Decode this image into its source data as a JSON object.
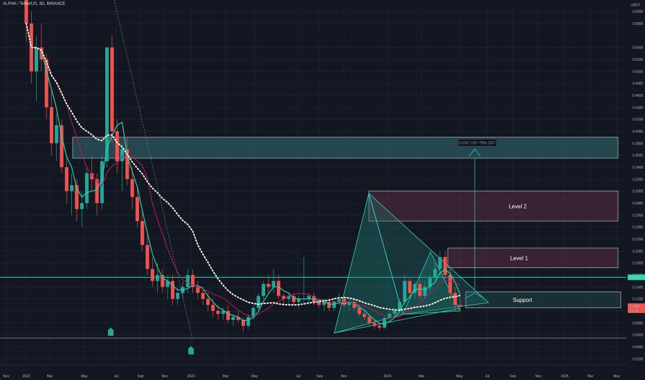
{
  "header": {
    "title": "ALPHA / TetherUS, 3D, BINANCE"
  },
  "colors": {
    "background": "#131722",
    "grid": "#1e222d",
    "up_candle": "#26a69a",
    "down_candle": "#ef5350",
    "ema_fast": "#26d4b0",
    "ema_slow": "#c2185b",
    "dotted_ma": "#f5f5dc",
    "support_line": "#2bd9b7",
    "target_zone": "#2e5a62",
    "resistance_zone": "#4a2a3a",
    "triangle_fill": "#1f8c7e",
    "arrow": "#26c6b0",
    "signal_marker": "#26a69a"
  },
  "chart_data": {
    "type": "candlestick",
    "title": "ALPHA / TetherUS, 3D, BINANCE",
    "y_axis": {
      "unit": "USDT",
      "ticks": [
        "0.6000",
        "0.5800",
        "0.5400",
        "0.5200",
        "0.5000",
        "0.4800",
        "0.4600",
        "0.4400",
        "0.4200",
        "0.4000",
        "0.3800",
        "0.3600",
        "0.3400",
        "0.3200",
        "0.3000",
        "0.2800",
        "0.2600",
        "0.2400",
        "0.2200",
        "0.2000",
        "0.1800",
        "0.1600",
        "0.1400",
        "0.1200",
        "0.1000",
        "0.0800",
        "0.0600",
        "0.0400",
        "0.0200"
      ],
      "ylim": [
        0.02,
        0.6
      ]
    },
    "x_axis": {
      "ticks": [
        "Nov",
        "2022",
        "Mar",
        "May",
        "Jul",
        "Sep",
        "Nov",
        "2023",
        "Mar",
        "May",
        "Jul",
        "Sep",
        "Nov",
        "2024",
        "Mar",
        "May",
        "Jul",
        "Sep",
        "Nov",
        "2025",
        "Mar",
        "May"
      ]
    },
    "price_labels": {
      "support_line": "0.1561",
      "current_price": "0.1080",
      "countdown": "1d 4h"
    },
    "measure_label": "0.2327 (167.75%) 2327",
    "zones": [
      {
        "name": "target",
        "label": "",
        "y_top": 0.39,
        "y_bottom": 0.355
      },
      {
        "name": "level2",
        "label": "Level 2",
        "y_top": 0.3,
        "y_bottom": 0.25
      },
      {
        "name": "level1",
        "label": "Level 1",
        "y_top": 0.205,
        "y_bottom": 0.172
      },
      {
        "name": "support",
        "label": "Support",
        "y_top": 0.132,
        "y_bottom": 0.105
      }
    ],
    "horizontal_lines": [
      {
        "name": "support-line",
        "value": 0.1561
      },
      {
        "name": "floor-line",
        "value": 0.0548
      }
    ],
    "candles": [
      [
        0.62,
        0.64,
        0.55,
        0.58
      ],
      [
        0.58,
        0.6,
        0.48,
        0.5
      ],
      [
        0.5,
        0.56,
        0.45,
        0.54
      ],
      [
        0.54,
        0.58,
        0.5,
        0.52
      ],
      [
        0.52,
        0.53,
        0.42,
        0.44
      ],
      [
        0.44,
        0.47,
        0.36,
        0.38
      ],
      [
        0.38,
        0.43,
        0.35,
        0.41
      ],
      [
        0.41,
        0.42,
        0.33,
        0.34
      ],
      [
        0.34,
        0.36,
        0.28,
        0.3
      ],
      [
        0.3,
        0.33,
        0.26,
        0.31
      ],
      [
        0.31,
        0.32,
        0.25,
        0.27
      ],
      [
        0.27,
        0.3,
        0.24,
        0.28
      ],
      [
        0.28,
        0.34,
        0.27,
        0.33
      ],
      [
        0.33,
        0.36,
        0.3,
        0.32
      ],
      [
        0.32,
        0.33,
        0.26,
        0.28
      ],
      [
        0.28,
        0.36,
        0.27,
        0.35
      ],
      [
        0.35,
        0.54,
        0.34,
        0.54
      ],
      [
        0.54,
        0.56,
        0.38,
        0.4
      ],
      [
        0.4,
        0.42,
        0.33,
        0.35
      ],
      [
        0.35,
        0.38,
        0.3,
        0.37
      ],
      [
        0.37,
        0.39,
        0.31,
        0.32
      ],
      [
        0.32,
        0.34,
        0.27,
        0.29
      ],
      [
        0.29,
        0.31,
        0.24,
        0.25
      ],
      [
        0.25,
        0.27,
        0.2,
        0.21
      ],
      [
        0.21,
        0.23,
        0.16,
        0.17
      ],
      [
        0.17,
        0.19,
        0.14,
        0.15
      ],
      [
        0.15,
        0.18,
        0.13,
        0.16
      ],
      [
        0.16,
        0.17,
        0.13,
        0.14
      ],
      [
        0.14,
        0.16,
        0.12,
        0.15
      ],
      [
        0.15,
        0.16,
        0.11,
        0.12
      ],
      [
        0.12,
        0.14,
        0.11,
        0.13
      ],
      [
        0.13,
        0.15,
        0.12,
        0.14
      ],
      [
        0.14,
        0.17,
        0.13,
        0.16
      ],
      [
        0.16,
        0.17,
        0.13,
        0.14
      ],
      [
        0.14,
        0.15,
        0.12,
        0.13
      ],
      [
        0.13,
        0.14,
        0.11,
        0.12
      ],
      [
        0.12,
        0.13,
        0.1,
        0.11
      ],
      [
        0.11,
        0.12,
        0.09,
        0.1
      ],
      [
        0.1,
        0.11,
        0.085,
        0.095
      ],
      [
        0.095,
        0.105,
        0.085,
        0.1
      ],
      [
        0.1,
        0.11,
        0.08,
        0.085
      ],
      [
        0.085,
        0.095,
        0.075,
        0.09
      ],
      [
        0.09,
        0.1,
        0.08,
        0.085
      ],
      [
        0.085,
        0.09,
        0.065,
        0.075
      ],
      [
        0.075,
        0.095,
        0.07,
        0.09
      ],
      [
        0.09,
        0.11,
        0.085,
        0.105
      ],
      [
        0.105,
        0.13,
        0.1,
        0.125
      ],
      [
        0.125,
        0.15,
        0.12,
        0.145
      ],
      [
        0.145,
        0.16,
        0.13,
        0.14
      ],
      [
        0.14,
        0.17,
        0.13,
        0.15
      ],
      [
        0.15,
        0.16,
        0.12,
        0.125
      ],
      [
        0.125,
        0.13,
        0.11,
        0.12
      ],
      [
        0.12,
        0.13,
        0.11,
        0.125
      ],
      [
        0.125,
        0.13,
        0.11,
        0.115
      ],
      [
        0.115,
        0.125,
        0.105,
        0.12
      ],
      [
        0.12,
        0.19,
        0.11,
        0.12
      ],
      [
        0.12,
        0.13,
        0.11,
        0.125
      ],
      [
        0.125,
        0.13,
        0.11,
        0.115
      ],
      [
        0.115,
        0.12,
        0.105,
        0.11
      ],
      [
        0.11,
        0.12,
        0.1,
        0.115
      ],
      [
        0.115,
        0.12,
        0.1,
        0.105
      ],
      [
        0.105,
        0.12,
        0.1,
        0.115
      ],
      [
        0.115,
        0.13,
        0.11,
        0.12
      ],
      [
        0.12,
        0.125,
        0.105,
        0.11
      ],
      [
        0.11,
        0.12,
        0.1,
        0.115
      ],
      [
        0.115,
        0.12,
        0.1,
        0.105
      ],
      [
        0.105,
        0.11,
        0.09,
        0.095
      ],
      [
        0.095,
        0.1,
        0.085,
        0.09
      ],
      [
        0.09,
        0.095,
        0.075,
        0.08
      ],
      [
        0.08,
        0.085,
        0.07,
        0.075
      ],
      [
        0.075,
        0.08,
        0.068,
        0.072
      ],
      [
        0.072,
        0.09,
        0.07,
        0.088
      ],
      [
        0.088,
        0.1,
        0.085,
        0.095
      ],
      [
        0.095,
        0.105,
        0.09,
        0.1
      ],
      [
        0.1,
        0.12,
        0.095,
        0.115
      ],
      [
        0.115,
        0.16,
        0.11,
        0.15
      ],
      [
        0.15,
        0.155,
        0.12,
        0.13
      ],
      [
        0.13,
        0.15,
        0.12,
        0.145
      ],
      [
        0.145,
        0.15,
        0.12,
        0.125
      ],
      [
        0.125,
        0.15,
        0.12,
        0.14
      ],
      [
        0.14,
        0.16,
        0.13,
        0.155
      ],
      [
        0.155,
        0.18,
        0.15,
        0.17
      ],
      [
        0.17,
        0.2,
        0.16,
        0.19
      ],
      [
        0.19,
        0.2,
        0.15,
        0.16
      ],
      [
        0.16,
        0.17,
        0.12,
        0.13
      ],
      [
        0.13,
        0.14,
        0.1,
        0.11
      ],
      [
        0.11,
        0.12,
        0.1,
        0.108
      ]
    ]
  }
}
